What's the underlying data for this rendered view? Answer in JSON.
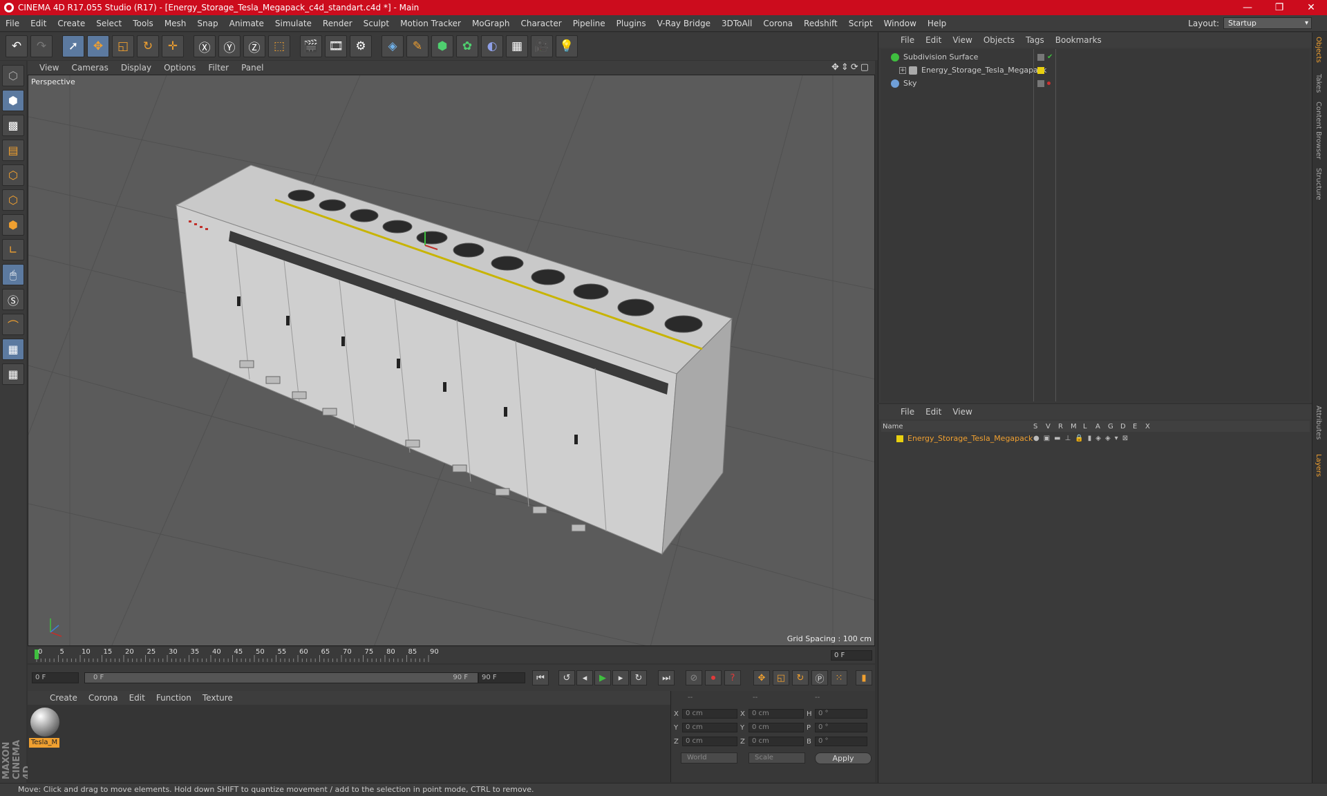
{
  "window": {
    "title": "CINEMA 4D R17.055 Studio (R17) - [Energy_Storage_Tesla_Megapack_c4d_standart.c4d *] - Main",
    "controls": [
      "—",
      "❐",
      "✕"
    ]
  },
  "menubar": {
    "items": [
      "File",
      "Edit",
      "Create",
      "Select",
      "Tools",
      "Mesh",
      "Snap",
      "Animate",
      "Simulate",
      "Render",
      "Sculpt",
      "Motion Tracker",
      "MoGraph",
      "Character",
      "Pipeline",
      "Plugins",
      "V-Ray Bridge",
      "3DToAll",
      "Corona",
      "Redshift",
      "Script",
      "Window",
      "Help"
    ],
    "layout_label": "Layout:",
    "layout_value": "Startup"
  },
  "viewport": {
    "menu": [
      "View",
      "Cameras",
      "Display",
      "Options",
      "Filter",
      "Panel"
    ],
    "camera_label": "Perspective",
    "grid_spacing": "Grid Spacing : 100 cm",
    "nav_icons": "✥⇕⟳▢"
  },
  "timeline": {
    "ticks": [
      "0",
      "5",
      "10",
      "15",
      "20",
      "25",
      "30",
      "35",
      "40",
      "45",
      "50",
      "55",
      "60",
      "65",
      "70",
      "75",
      "80",
      "85",
      "90"
    ],
    "current_frame": "0 F",
    "start_field": "0 F",
    "range_start": "0 F",
    "range_end": "90 F",
    "end_field": "90 F"
  },
  "material_manager": {
    "menu": [
      "Create",
      "Corona",
      "Edit",
      "Function",
      "Texture"
    ],
    "material_name": "Tesla_M"
  },
  "coordinates": {
    "header": [
      "--",
      "--",
      "--"
    ],
    "rows": [
      {
        "a": "X",
        "v1": "0 cm",
        "b": "X",
        "v2": "0 cm",
        "c": "H",
        "v3": "0 °"
      },
      {
        "a": "Y",
        "v1": "0 cm",
        "b": "Y",
        "v2": "0 cm",
        "c": "P",
        "v3": "0 °"
      },
      {
        "a": "Z",
        "v1": "0 cm",
        "b": "Z",
        "v2": "0 cm",
        "c": "B",
        "v3": "0 °"
      }
    ],
    "mode1": "World",
    "mode2": "Scale",
    "apply": "Apply"
  },
  "object_manager": {
    "menu": [
      "File",
      "Edit",
      "View",
      "Objects",
      "Tags",
      "Bookmarks"
    ],
    "objects": [
      {
        "name": "Subdivision Surface",
        "color": "#3fbf3f"
      },
      {
        "name": "Energy_Storage_Tesla_Megapack",
        "color": "#aaaaaa"
      },
      {
        "name": "Sky",
        "color": "#6f9fd8"
      }
    ]
  },
  "layer_manager": {
    "menu": [
      "File",
      "Edit",
      "View"
    ],
    "columns": [
      "Name",
      "S",
      "V",
      "R",
      "M",
      "L",
      "A",
      "G",
      "D",
      "E",
      "X"
    ],
    "layer_name": "Energy_Storage_Tesla_Megapack"
  },
  "right_tabs": [
    "Objects",
    "Takes",
    "Content Browser",
    "Structure",
    "Attributes",
    "Layers"
  ],
  "brand": "MAXON CINEMA 4D",
  "statusbar": "Move: Click and drag to move elements. Hold down SHIFT to quantize movement / add to the selection in point mode, CTRL to remove.",
  "colors": {
    "titlebar": "#cc0c1d",
    "accent": "#f0a030",
    "tool_active": "#5c7aa0"
  }
}
